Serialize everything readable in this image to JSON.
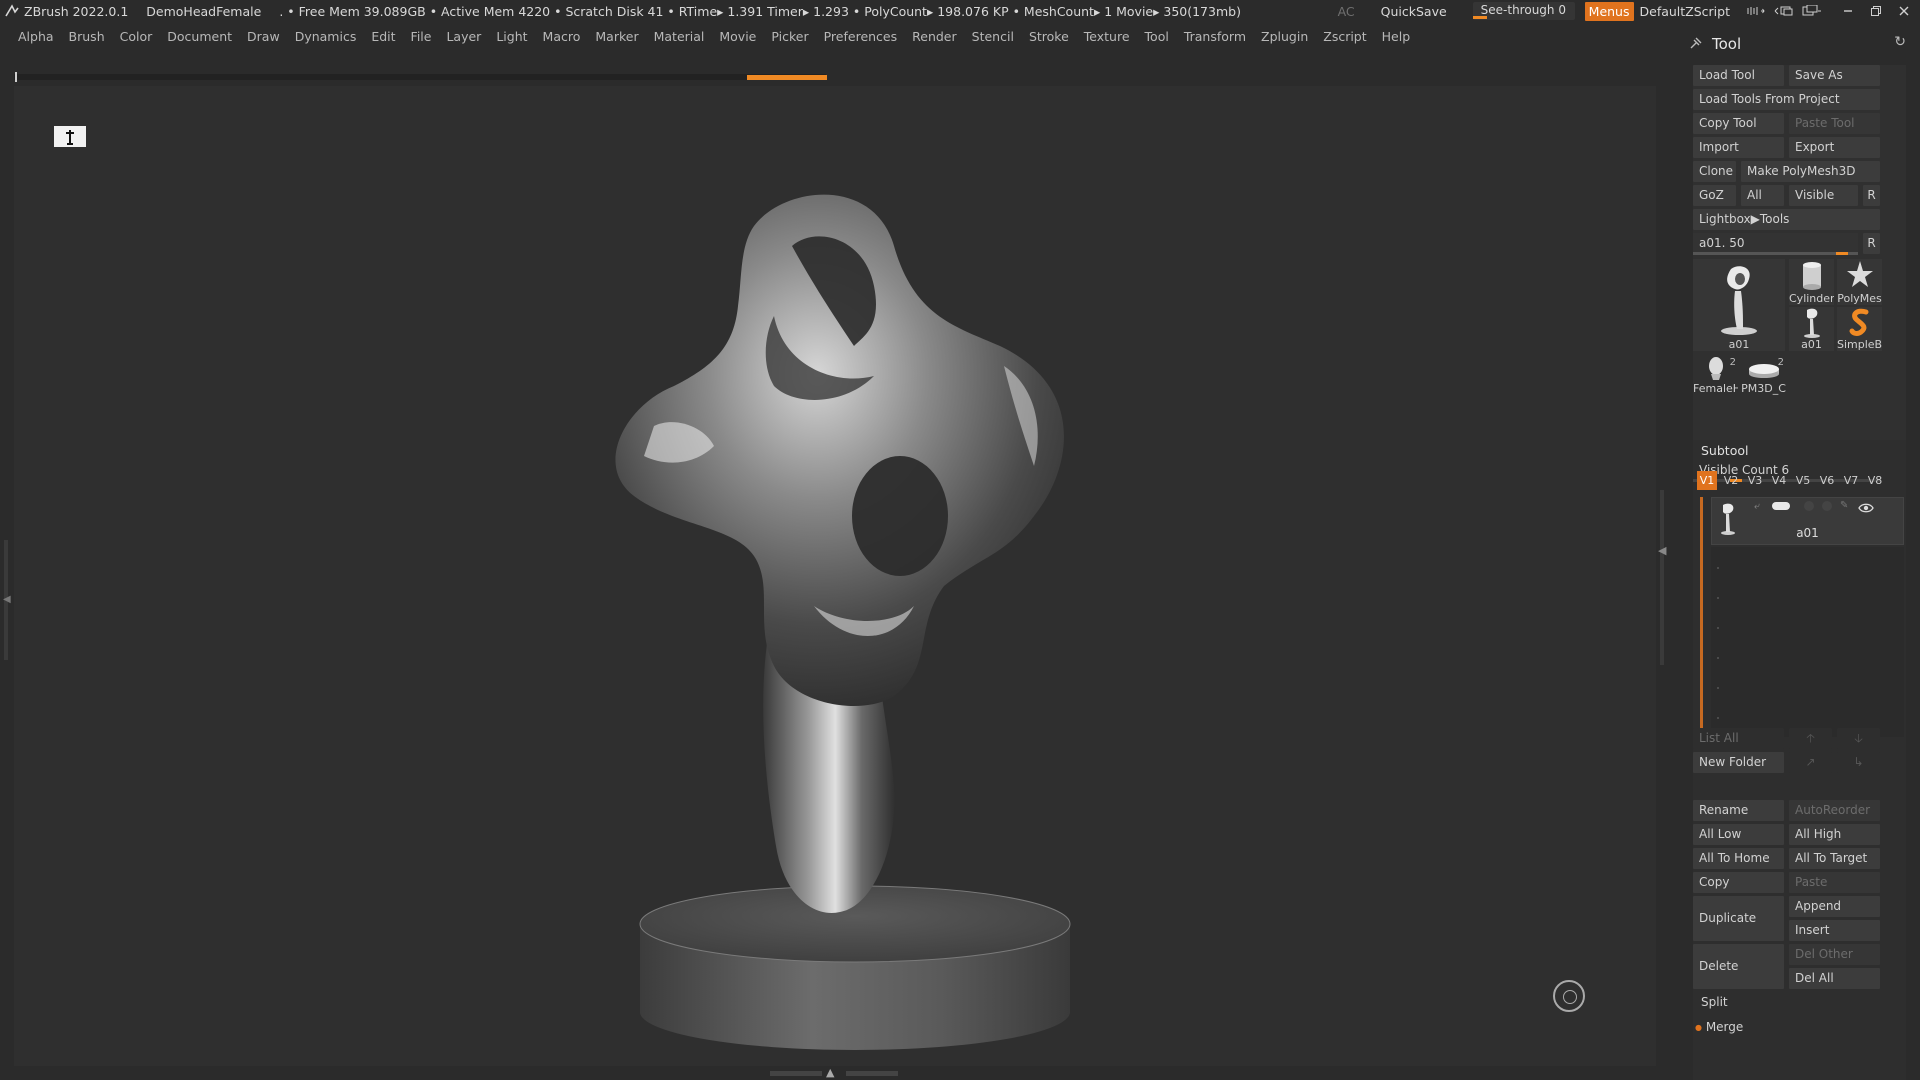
{
  "titlebar": {
    "app": "ZBrush 2022.0.1",
    "project": "DemoHeadFemale",
    "stats": ". • Free Mem 39.089GB • Active Mem 4220 • Scratch Disk 41 •   RTime▸ 1.391 Timer▸ 1.293 • PolyCount▸ 198.076 KP  • MeshCount▸ 1   Movie▸ 350(173mb)",
    "ac": "AC",
    "quicksave": "QuickSave",
    "seethrough": "See-through   0",
    "menus": "Menus",
    "script": "DefaultZScript"
  },
  "menubar": {
    "items": [
      "Alpha",
      "Brush",
      "Color",
      "Document",
      "Draw",
      "Dynamics",
      "Edit",
      "File",
      "Layer",
      "Light",
      "Macro",
      "Marker",
      "Material",
      "Movie",
      "Picker",
      "Preferences",
      "Render",
      "Stencil",
      "Stroke",
      "Texture",
      "Tool",
      "Transform",
      "Zplugin",
      "Zscript",
      "Help"
    ]
  },
  "palette": {
    "title": "Tool",
    "load_tool": "Load Tool",
    "save_as": "Save As",
    "load_from_project": "Load Tools From Project",
    "copy_tool": "Copy Tool",
    "paste_tool": "Paste Tool",
    "import": "Import",
    "export": "Export",
    "clone": "Clone",
    "make_polymesh": "Make PolyMesh3D",
    "goz": "GoZ",
    "all": "All",
    "visible": "Visible",
    "r": "R",
    "lightbox_tools": "Lightbox▶Tools",
    "tool_slider_label": "a01. 50",
    "tool_slider_value": 0.94,
    "thumbs": [
      {
        "label": "a01",
        "count": ""
      },
      {
        "label": "Cylinder",
        "count": ""
      },
      {
        "label": "PolyMes",
        "count": ""
      },
      {
        "label": "a01",
        "count": ""
      },
      {
        "label": "SimpleB",
        "count": ""
      },
      {
        "label": "FemaleH",
        "count": "2"
      },
      {
        "label": "PM3D_C",
        "count": "2"
      }
    ]
  },
  "subtool": {
    "title": "Subtool",
    "visible_count": "Visible Count 6",
    "visible_count_value": 0.2,
    "versions": [
      "V1",
      "V2",
      "V3",
      "V4",
      "V5",
      "V6",
      "V7",
      "V8"
    ],
    "active_version": "V1",
    "item_name": "a01",
    "list_all": "List All",
    "new_folder": "New Folder",
    "rename": "Rename",
    "autoreorder": "AutoReorder",
    "all_low": "All Low",
    "all_high": "All High",
    "all_to_home": "All To Home",
    "all_to_target": "All To Target",
    "copy": "Copy",
    "paste": "Paste",
    "duplicate": "Duplicate",
    "append": "Append",
    "insert": "Insert",
    "delete": "Delete",
    "del_other": "Del Other",
    "del_all": "Del All",
    "split": "Split",
    "merge": "Merge"
  },
  "colors": {
    "accent": "#e0731e",
    "panel": "#2b2b2b",
    "viewport": "#2f2f2f"
  }
}
